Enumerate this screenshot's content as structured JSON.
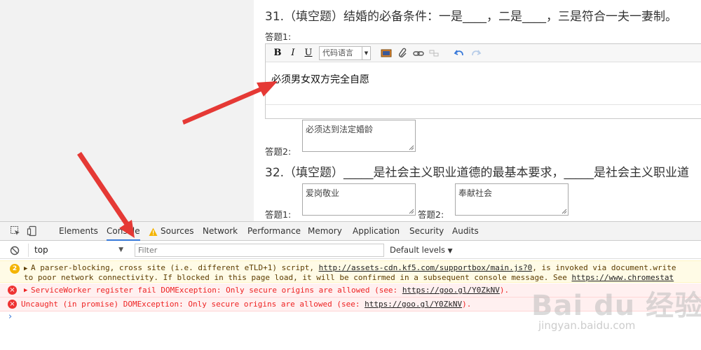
{
  "page": {
    "q31": {
      "title": "31.（填空题）结婚的必备条件：一是____，二是____，三是符合一夫一妻制。",
      "answer1_label": "答题1:",
      "answer2_label": "答题2:",
      "editor": {
        "bold": "B",
        "italic": "I",
        "underline": "U",
        "code_lang": "代码语言",
        "content": "必须男女双方完全自愿"
      },
      "answer2_value": "必须达到法定婚龄"
    },
    "q32": {
      "title": "32.（填空题）_____是社会主义职业道德的最基本要求，_____是社会主义职业道",
      "answer1_label": "答题1:",
      "answer2_label": "答题2:",
      "answer1_value": "爱岗敬业",
      "answer2_value": "奉献社会"
    }
  },
  "devtools": {
    "tabs": [
      "Elements",
      "Console",
      "Sources",
      "Network",
      "Performance",
      "Memory",
      "Application",
      "Security",
      "Audits"
    ],
    "active_tab": "Console",
    "context": "top",
    "filter_placeholder": "Filter",
    "levels": "Default levels",
    "messages": [
      {
        "level": "warning",
        "count": "2",
        "pre": "A parser-blocking, cross site (i.e. different eTLD+1) script, ",
        "link": "http://assets-cdn.kf5.com/supportbox/main.js?0",
        "post": ", is invoked via document.write",
        "line2_pre": "to poor network connectivity. If blocked in this page load, it will be confirmed in a subsequent console message. See ",
        "line2_link": "https://www.chromestat"
      },
      {
        "level": "error",
        "pre": "ServiceWorker register fail DOMException: Only secure origins are allowed (see: ",
        "link": "https://goo.gl/Y0ZkNV",
        "post": ")."
      },
      {
        "level": "error",
        "pre": "Uncaught (in promise) DOMException: Only secure origins are allowed (see: ",
        "link": "https://goo.gl/Y0ZkNV",
        "post": ")."
      }
    ],
    "prompt": "›"
  },
  "watermark": {
    "main": "Bai du 经验",
    "sub": "jingyan.baidu.com"
  },
  "colors": {
    "accent": "#3879d9",
    "error": "#e22222",
    "warning": "#f4b400",
    "annotation_arrow": "#e53935"
  }
}
